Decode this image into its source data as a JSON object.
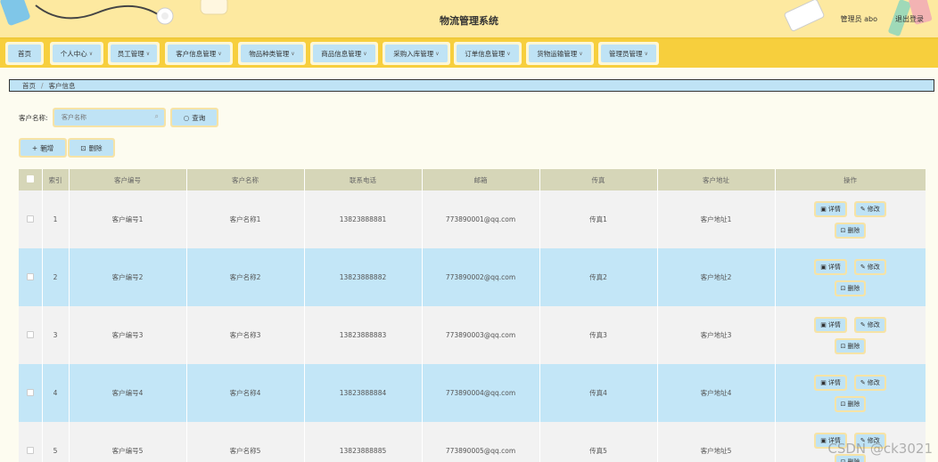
{
  "header": {
    "title": "物流管理系统",
    "user": "管理员 abo",
    "logout": "退出登录"
  },
  "nav": [
    {
      "label": "首页",
      "dropdown": false
    },
    {
      "label": "个人中心",
      "dropdown": true
    },
    {
      "label": "员工管理",
      "dropdown": true
    },
    {
      "label": "客户信息管理",
      "dropdown": true
    },
    {
      "label": "物品种类管理",
      "dropdown": true
    },
    {
      "label": "商品信息管理",
      "dropdown": true
    },
    {
      "label": "采购入库管理",
      "dropdown": true
    },
    {
      "label": "订单信息管理",
      "dropdown": true
    },
    {
      "label": "货物运输管理",
      "dropdown": true
    },
    {
      "label": "管理员管理",
      "dropdown": true
    }
  ],
  "breadcrumb": {
    "home": "首页",
    "current": "客户信息"
  },
  "search": {
    "label": "客户名称",
    "placeholder": "客户名称",
    "query_button": "查询"
  },
  "actions": {
    "add": "新增",
    "delete": "删除"
  },
  "table": {
    "columns": [
      "索引",
      "客户编号",
      "客户名称",
      "联系电话",
      "邮箱",
      "传真",
      "客户地址",
      "操作"
    ],
    "rows": [
      {
        "index": "1",
        "code": "客户编号1",
        "name": "客户名称1",
        "phone": "13823888881",
        "email": "773890001@qq.com",
        "fax": "传真1",
        "address": "客户地址1"
      },
      {
        "index": "2",
        "code": "客户编号2",
        "name": "客户名称2",
        "phone": "13823888882",
        "email": "773890002@qq.com",
        "fax": "传真2",
        "address": "客户地址2"
      },
      {
        "index": "3",
        "code": "客户编号3",
        "name": "客户名称3",
        "phone": "13823888883",
        "email": "773890003@qq.com",
        "fax": "传真3",
        "address": "客户地址3"
      },
      {
        "index": "4",
        "code": "客户编号4",
        "name": "客户名称4",
        "phone": "13823888884",
        "email": "773890004@qq.com",
        "fax": "传真4",
        "address": "客户地址4"
      },
      {
        "index": "5",
        "code": "客户编号5",
        "name": "客户名称5",
        "phone": "13823888885",
        "email": "773890005@qq.com",
        "fax": "传真5",
        "address": "客户地址5"
      }
    ],
    "row_ops": {
      "detail": "详情",
      "edit": "修改",
      "delete": "删除"
    }
  },
  "watermark": "CSDN @ck3021",
  "colors": {
    "accent_yellow": "#f7cf3d",
    "accent_blue": "#bfe3f5",
    "header_bg": "#fde9a0"
  }
}
